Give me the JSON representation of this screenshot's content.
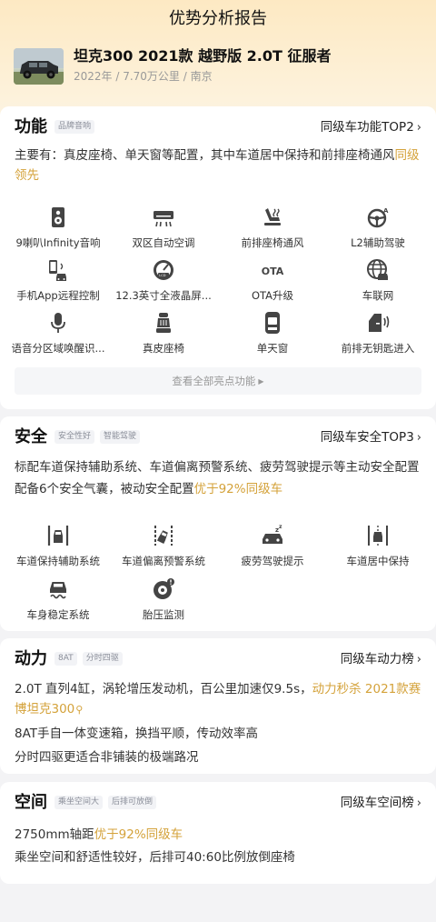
{
  "page_title": "优势分析报告",
  "car": {
    "name": "坦克300 2021款 越野版 2.0T 征服者",
    "meta": "2022年 / 7.70万公里 / 南京"
  },
  "function": {
    "title": "功能",
    "tags": [
      "品牌音响"
    ],
    "rank": "同级车功能TOP2",
    "desc_main": "主要有：真皮座椅、单天窗等配置，其中车道居中保持和前排座椅通风",
    "desc_hl": "同级领先",
    "items": [
      {
        "icon": "speaker-icon",
        "label": "9喇叭Infinity音响"
      },
      {
        "icon": "air-conditioner-icon",
        "label": "双区自动空调"
      },
      {
        "icon": "seat-ventilation-icon",
        "label": "前排座椅通风"
      },
      {
        "icon": "steering-wheel-assist-icon",
        "label": "L2辅助驾驶"
      },
      {
        "icon": "phone-car-remote-icon",
        "label": "手机App远程控制"
      },
      {
        "icon": "lcd-dashboard-icon",
        "label": "12.3英寸全液晶屏..."
      },
      {
        "icon": "ota-icon",
        "label": "OTA升级",
        "glyph": "OTA"
      },
      {
        "icon": "globe-car-icon",
        "label": "车联网"
      },
      {
        "icon": "microphone-icon",
        "label": "语音分区域唤醒识..."
      },
      {
        "icon": "leather-seat-icon",
        "label": "真皮座椅"
      },
      {
        "icon": "sunroof-icon",
        "label": "单天窗"
      },
      {
        "icon": "keyless-door-icon",
        "label": "前排无钥匙进入"
      }
    ],
    "view_all": "查看全部亮点功能"
  },
  "safety": {
    "title": "安全",
    "tags": [
      "安全性好",
      "智能驾驶"
    ],
    "rank": "同级车安全TOP3",
    "desc_line1": "标配车道保持辅助系统、车道偏离预警系统、疲劳驾驶提示等主动安全配置",
    "desc_line2_main": "配备6个安全气囊，被动安全配置",
    "desc_line2_hl": "优于92%同级车",
    "items": [
      {
        "icon": "lane-keep-icon",
        "label": "车道保持辅助系统"
      },
      {
        "icon": "lane-departure-icon",
        "label": "车道偏离预警系统"
      },
      {
        "icon": "fatigue-driving-icon",
        "label": "疲劳驾驶提示"
      },
      {
        "icon": "lane-center-icon",
        "label": "车道居中保持"
      },
      {
        "icon": "stability-control-icon",
        "label": "车身稳定系统"
      },
      {
        "icon": "tire-pressure-icon",
        "label": "胎压监测"
      }
    ]
  },
  "power": {
    "title": "动力",
    "tags": [
      "8AT",
      "分时四驱"
    ],
    "rank": "同级车动力榜",
    "desc_line1_main": "2.0T 直列4缸，涡轮增压发动机，百公里加速仅9.5s，",
    "desc_line1_hl": "动力秒杀 2021款赛博坦克300",
    "desc_line2": "8AT手自一体变速箱，换挡平顺，传动效率高",
    "desc_line3": "分时四驱更适合非铺装的极端路况"
  },
  "space": {
    "title": "空间",
    "tags": [
      "乘坐空间大",
      "后排可放倒"
    ],
    "rank": "同级车空间榜",
    "desc_line1_main": "2750mm轴距",
    "desc_line1_hl": "优于92%同级车",
    "desc_line2": "乘坐空间和舒适性较好，后排可40:60比例放倒座椅"
  },
  "colors": {
    "accent": "#d4a23a",
    "hero_top": "#fde9c3",
    "background": "#f3f3f5",
    "icon": "#444444"
  }
}
